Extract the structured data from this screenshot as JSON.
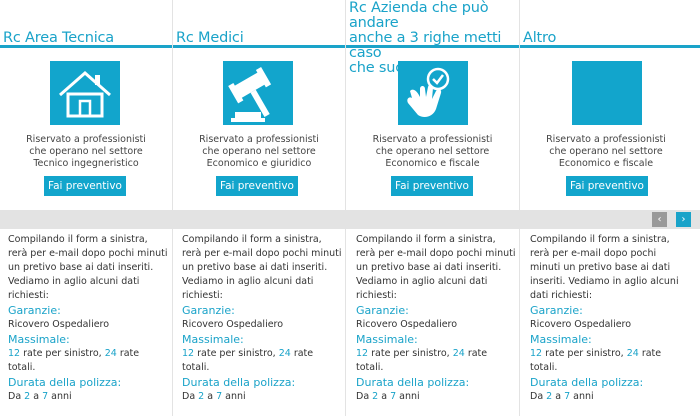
{
  "columns": [
    {
      "title": "Rc Area Tecnica",
      "icon": "house-icon",
      "desc": [
        "Riservato a professionisti",
        "che operano nel settore",
        "Tecnico ingegneristico"
      ],
      "button": "Fai preventivo",
      "intro": "Compilando il form a sinistra, rerà per e-mail dopo pochi minuti un pretivo base ai dati inseriti. Vediamo in aglio alcuni dati richiesti:",
      "garanzie_label": "Garanzie:",
      "garanzie_value": "Ricovero Ospedaliero",
      "massimale_label": "Massimale:",
      "massimale_a": "12",
      "massimale_mid": " rate per sinistro, ",
      "massimale_b": "24",
      "massimale_end": " rate totali.",
      "durata_label": "Durata della polizza:",
      "durata_pre": "Da ",
      "durata_a": "2",
      "durata_mid": " a ",
      "durata_b": "7",
      "durata_end": " anni"
    },
    {
      "title": "Rc Medici",
      "icon": "gavel-icon",
      "desc": [
        "Riservato a professionisti",
        "che operano nel settore",
        "Economico e giuridico"
      ],
      "button": "Fai preventivo",
      "intro": "Compilando il form a sinistra, rerà per e-mail dopo pochi minuti un pretivo base ai dati inseriti. Vediamo in aglio alcuni dati richiesti:",
      "garanzie_label": "Garanzie:",
      "garanzie_value": "Ricovero Ospedaliero",
      "massimale_label": "Massimale:",
      "massimale_a": "12",
      "massimale_mid": " rate per sinistro, ",
      "massimale_b": "24",
      "massimale_end": " rate totali.",
      "durata_label": "Durata della polizza:",
      "durata_pre": "Da ",
      "durata_a": "2",
      "durata_mid": " a ",
      "durata_b": "7",
      "durata_end": " anni"
    },
    {
      "title_lines": [
        "Rc Azienda che può andare",
        "anche a 3 righe metti caso",
        "che succede"
      ],
      "icon": "hand-check-icon",
      "desc": [
        "Riservato a professionisti",
        "che operano nel settore",
        "Economico e fiscale"
      ],
      "button": "Fai preventivo",
      "intro": "Compilando il form a sinistra, rerà per e-mail dopo pochi minuti un pretivo base ai dati inseriti. Vediamo in aglio alcuni dati richiesti:",
      "garanzie_label": "Garanzie:",
      "garanzie_value": "Ricovero Ospedaliero",
      "massimale_label": "Massimale:",
      "massimale_a": "12",
      "massimale_mid": " rate per sinistro, ",
      "massimale_b": "24",
      "massimale_end": " rate totali.",
      "durata_label": "Durata della polizza:",
      "durata_pre": "Da ",
      "durata_a": "2",
      "durata_mid": " a ",
      "durata_b": "7",
      "durata_end": " anni"
    },
    {
      "title": "Altro",
      "icon": "blank-icon",
      "desc": [
        "Riservato a professionisti",
        "che operano nel settore",
        "Economico e fiscale"
      ],
      "button": "Fai preventivo",
      "intro": "Compilando il form a sinistra, rerà per e-mail dopo pochi minuti un pretivo base ai dati inseriti. Vediamo in aglio alcuni dati richiesti:",
      "garanzie_label": "Garanzie:",
      "garanzie_value": "Ricovero Ospedaliero",
      "massimale_label": "Massimale:",
      "massimale_a": "12",
      "massimale_mid": " rate per sinistro, ",
      "massimale_b": "24",
      "massimale_end": " rate totali.",
      "durata_label": "Durata della polizza:",
      "durata_pre": "Da ",
      "durata_a": "2",
      "durata_mid": " a ",
      "durata_b": "7",
      "durata_end": " anni"
    }
  ],
  "nav": {
    "prev_icon": "chevron-left-icon",
    "next_icon": "chevron-right-icon",
    "prev_symbol": "‹",
    "next_symbol": "›"
  },
  "colors": {
    "accent": "#1aa3c9",
    "band": "#e3e3e3",
    "arrow_disabled": "#999999"
  }
}
